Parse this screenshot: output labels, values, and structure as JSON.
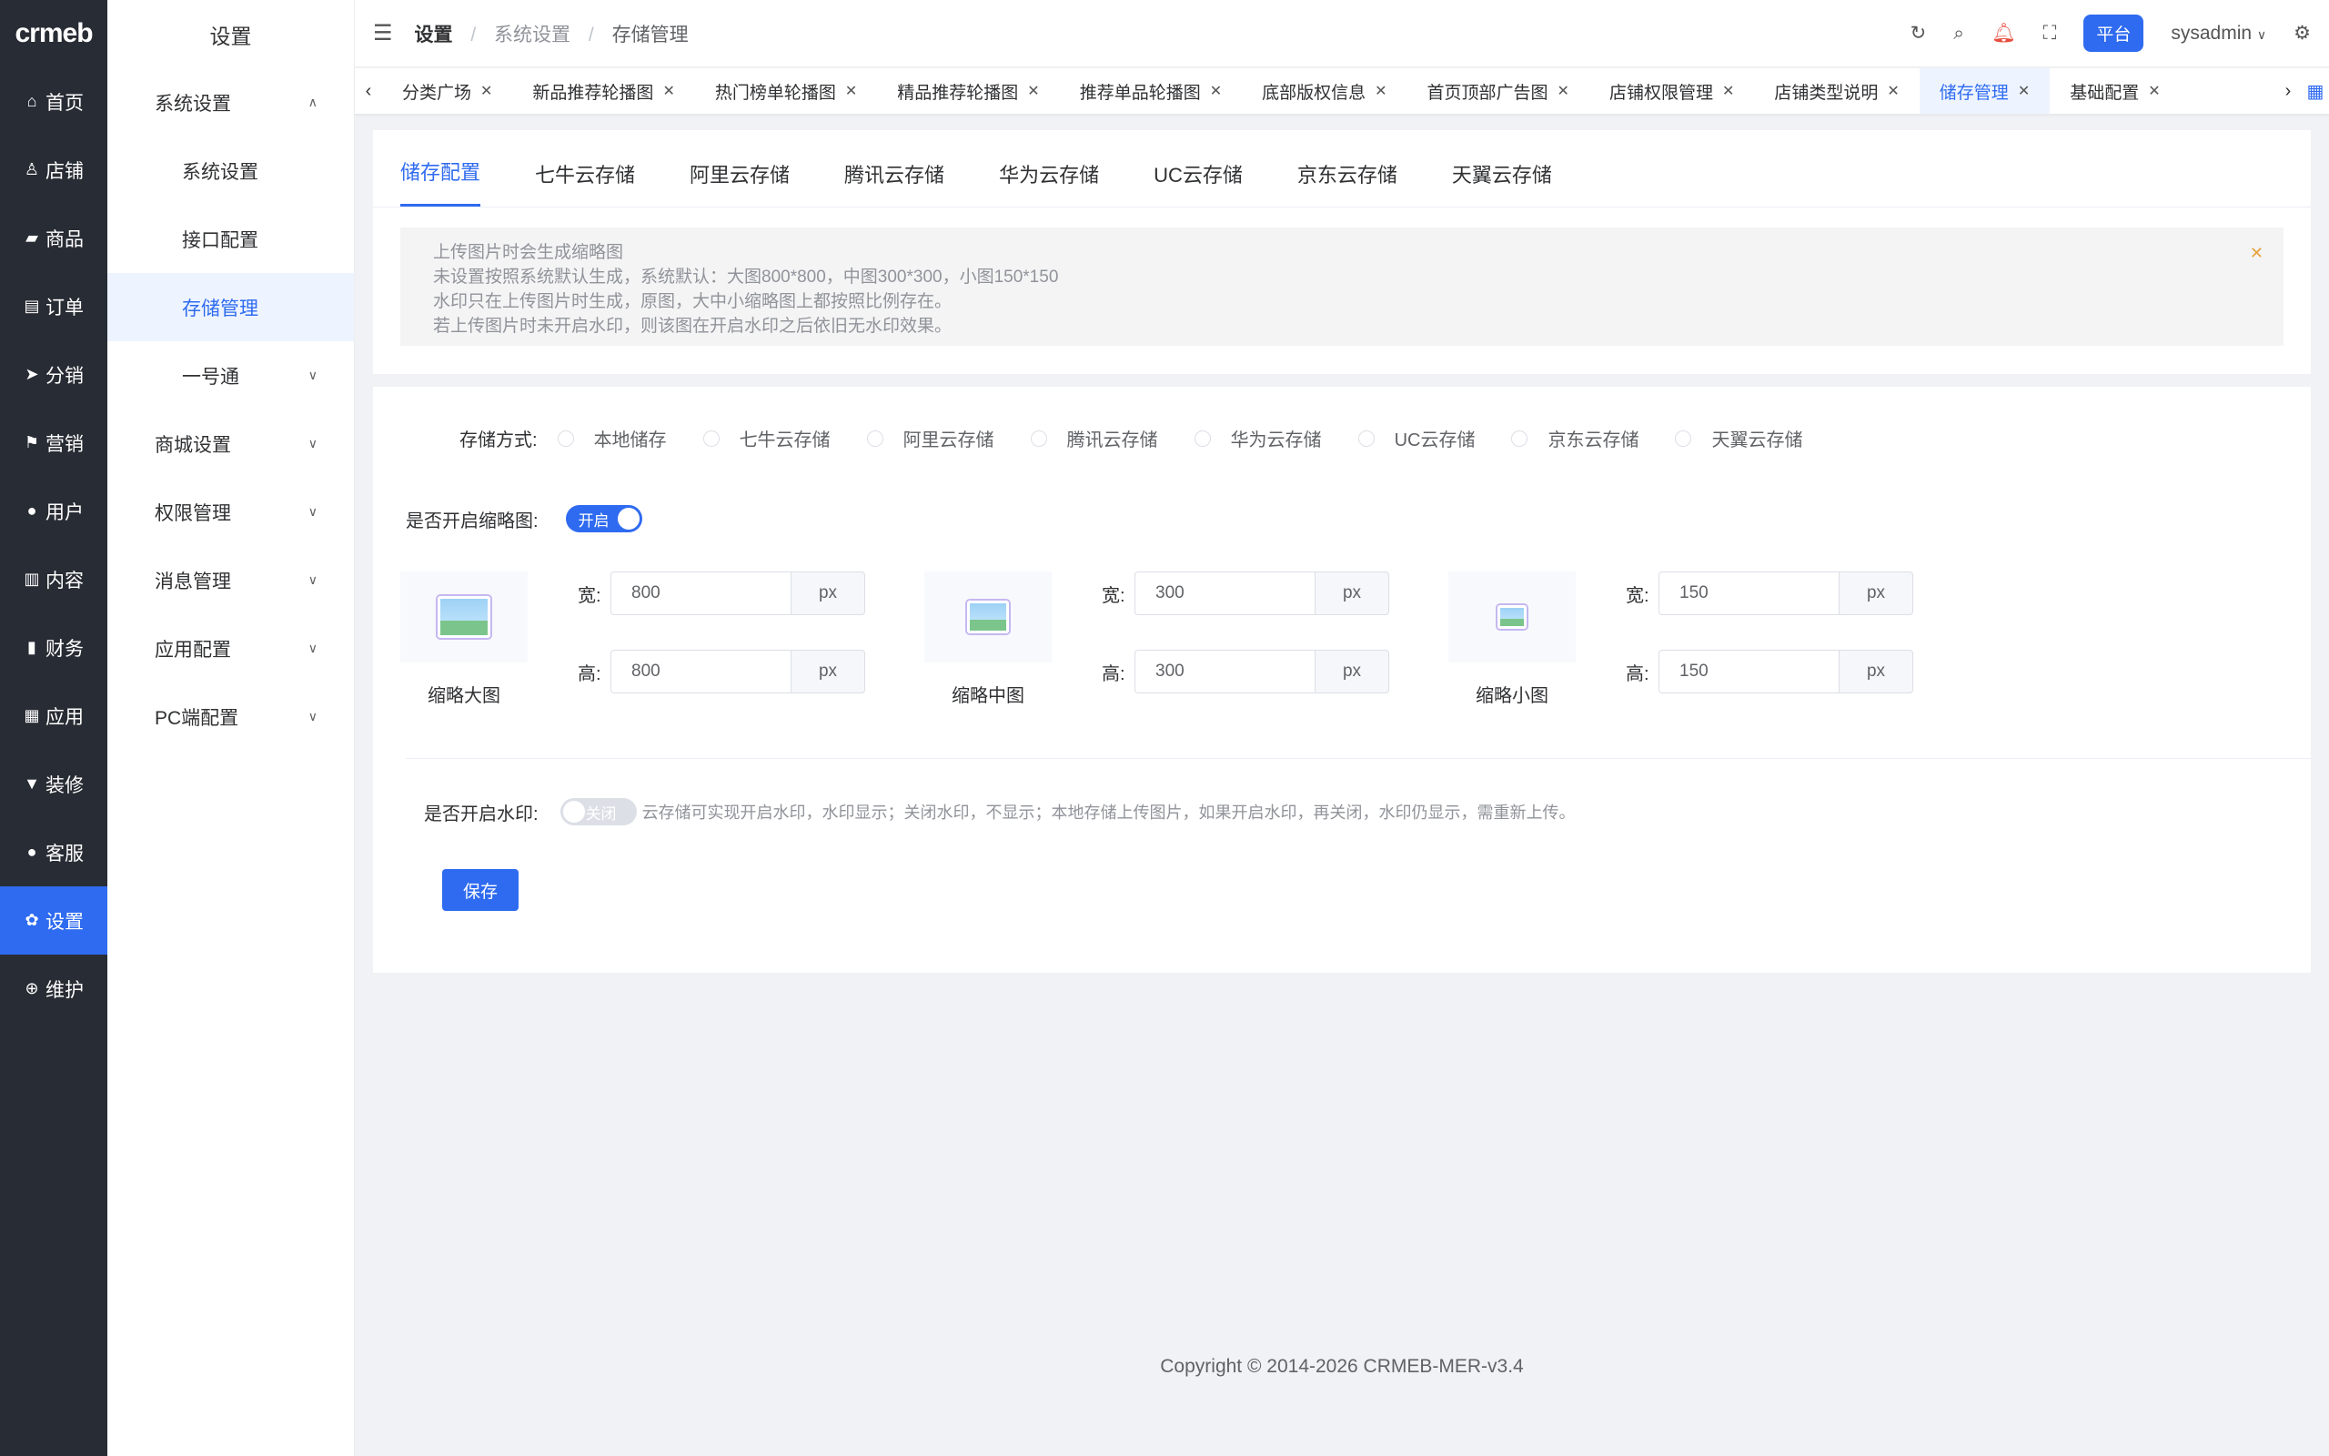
{
  "brand": "crmeb",
  "rail": [
    {
      "label": "首页",
      "icon": "home-icon",
      "glyph": "⌂"
    },
    {
      "label": "店铺",
      "icon": "shop-icon",
      "glyph": "♙"
    },
    {
      "label": "商品",
      "icon": "bag-icon",
      "glyph": "▰"
    },
    {
      "label": "订单",
      "icon": "order-icon",
      "glyph": "▤"
    },
    {
      "label": "分销",
      "icon": "send-icon",
      "glyph": "➤"
    },
    {
      "label": "营销",
      "icon": "flag-icon",
      "glyph": "⚑"
    },
    {
      "label": "用户",
      "icon": "user-icon",
      "glyph": "●"
    },
    {
      "label": "内容",
      "icon": "book-icon",
      "glyph": "▥"
    },
    {
      "label": "财务",
      "icon": "bar-chart-icon",
      "glyph": "▮"
    },
    {
      "label": "应用",
      "icon": "grid-icon",
      "glyph": "▦"
    },
    {
      "label": "装修",
      "icon": "brush-icon",
      "glyph": "▼"
    },
    {
      "label": "客服",
      "icon": "support-icon",
      "glyph": "●"
    },
    {
      "label": "设置",
      "icon": "gear-icon",
      "glyph": "✿"
    },
    {
      "label": "维护",
      "icon": "plus-circle-icon",
      "glyph": "⊕"
    }
  ],
  "subnav": {
    "title": "设置",
    "items": [
      {
        "label": "系统设置",
        "chevron": "up"
      },
      {
        "label": "系统设置",
        "child": true
      },
      {
        "label": "接口配置",
        "child": true
      },
      {
        "label": "存储管理",
        "child": true
      },
      {
        "label": "一号通",
        "child": true,
        "chevron": "down"
      },
      {
        "label": "商城设置",
        "chevron": "down"
      },
      {
        "label": "权限管理",
        "chevron": "down"
      },
      {
        "label": "消息管理",
        "chevron": "down"
      },
      {
        "label": "应用配置",
        "chevron": "down"
      },
      {
        "label": "PC端配置",
        "chevron": "down"
      }
    ]
  },
  "header": {
    "crumb1": "设置",
    "crumb2": "系统设置",
    "crumb3": "存储管理",
    "platform": "平台",
    "user": "sysadmin"
  },
  "tabs": [
    "分类广场",
    "新品推荐轮播图",
    "热门榜单轮播图",
    "精品推荐轮播图",
    "推荐单品轮播图",
    "底部版权信息",
    "首页顶部广告图",
    "店铺权限管理",
    "店铺类型说明",
    "储存管理",
    "基础配置"
  ],
  "active_tab": "储存管理",
  "subtabs": [
    "储存配置",
    "七牛云存储",
    "阿里云存储",
    "腾讯云存储",
    "华为云存储",
    "UC云存储",
    "京东云存储",
    "天翼云存储"
  ],
  "alert": {
    "line1": "上传图片时会生成缩略图",
    "line2": "未设置按照系统默认生成，系统默认：大图800*800，中图300*300，小图150*150",
    "line3": "水印只在上传图片时生成，原图，大中小缩略图上都按照比例存在。",
    "line4": "若上传图片时未开启水印，则该图在开启水印之后依旧无水印效果。"
  },
  "form": {
    "storage_label": "存储方式:",
    "storage_options": [
      "本地储存",
      "七牛云存储",
      "阿里云存储",
      "腾讯云存储",
      "华为云存储",
      "UC云存储",
      "京东云存储",
      "天翼云存储"
    ],
    "thumb_label": "是否开启缩略图:",
    "thumb_switch": "开启",
    "width_label": "宽:",
    "height_label": "高:",
    "unit": "px",
    "big": {
      "name": "缩略大图",
      "w": "800",
      "h": "800"
    },
    "mid": {
      "name": "缩略中图",
      "w": "300",
      "h": "300"
    },
    "small": {
      "name": "缩略小图",
      "w": "150",
      "h": "150"
    },
    "watermark_label": "是否开启水印:",
    "watermark_switch": "关闭",
    "watermark_tip": "云存储可实现开启水印，水印显示；关闭水印，不显示；本地存储上传图片，如果开启水印，再关闭，水印仍显示，需重新上传。",
    "save": "保存"
  },
  "footer": "Copyright © 2014-2026 CRMEB-MER-v3.4"
}
